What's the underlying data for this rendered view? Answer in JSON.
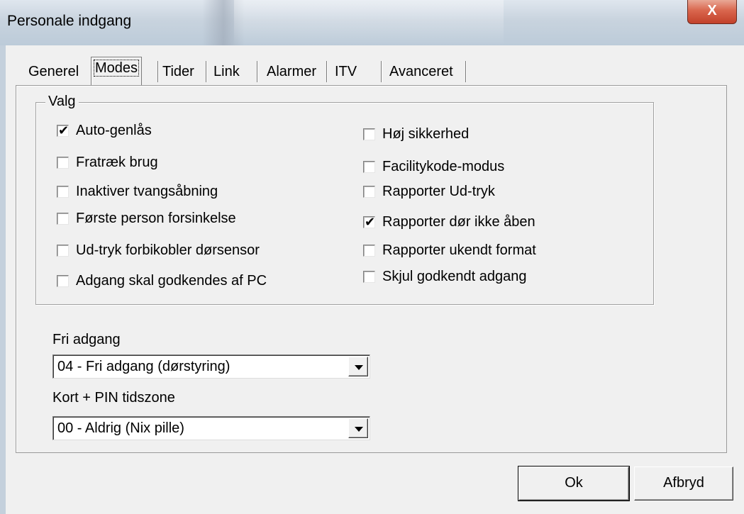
{
  "window": {
    "title": "Personale indgang",
    "close_label": "X"
  },
  "tabs": [
    {
      "label": "Generel",
      "selected": false
    },
    {
      "label": "Modes",
      "selected": true
    },
    {
      "label": "Tider",
      "selected": false
    },
    {
      "label": "Link",
      "selected": false
    },
    {
      "label": "Alarmer",
      "selected": false
    },
    {
      "label": "ITV",
      "selected": false
    },
    {
      "label": "Avanceret",
      "selected": false
    }
  ],
  "valg": {
    "legend": "Valg",
    "left": [
      {
        "label": "Auto-genlås",
        "checked": true
      },
      {
        "label": "Fratræk brug",
        "checked": false
      },
      {
        "label": "Inaktiver tvangsåbning",
        "checked": false
      },
      {
        "label": "Første person forsinkelse",
        "checked": false
      },
      {
        "label": "Ud-tryk forbikobler dørsensor",
        "checked": false
      },
      {
        "label": "Adgang skal godkendes af PC",
        "checked": false
      }
    ],
    "right": [
      {
        "label": "Høj sikkerhed",
        "checked": false
      },
      {
        "label": "Facilitykode-modus",
        "checked": false
      },
      {
        "label": "Rapporter Ud-tryk",
        "checked": false
      },
      {
        "label": "Rapporter dør ikke åben",
        "checked": true
      },
      {
        "label": "Rapporter ukendt format",
        "checked": false
      },
      {
        "label": "Skjul godkendt adgang",
        "checked": false
      }
    ]
  },
  "fri_adgang": {
    "label": "Fri adgang",
    "value": "04 - Fri adgang (dørstyring)"
  },
  "kort_pin": {
    "label": "Kort + PIN tidszone",
    "value": "00 - Aldrig (Nix pille)"
  },
  "buttons": {
    "ok": "Ok",
    "cancel": "Afbryd"
  },
  "check_glyph": "✔"
}
